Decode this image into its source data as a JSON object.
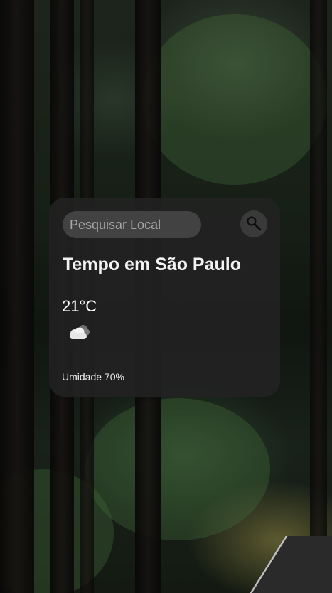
{
  "search": {
    "placeholder": "Pesquisar Local",
    "value": ""
  },
  "weather": {
    "title": "Tempo em São Paulo",
    "temperature": "21°C",
    "condition_icon": "cloud-icon",
    "humidity": "Umidade 70%"
  },
  "icons": {
    "search_button": "magnifier-icon"
  },
  "colors": {
    "card_background": "#222222",
    "input_background": "#5f5f5f",
    "text": "#ffffff",
    "placeholder": "#a6a6a6"
  }
}
